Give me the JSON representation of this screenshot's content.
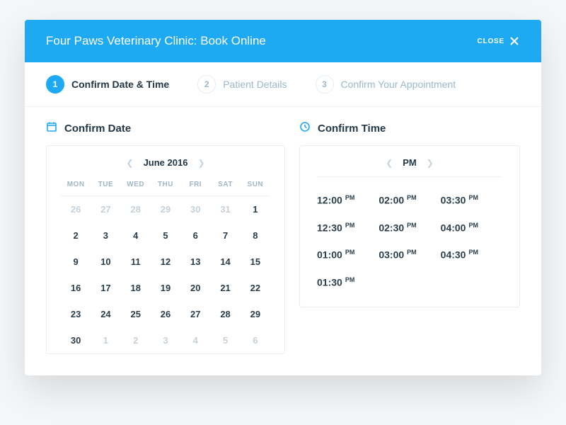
{
  "header": {
    "title": "Four Paws Veterinary Clinic: Book Online",
    "close_label": "CLOSE"
  },
  "steps": [
    {
      "num": "1",
      "label": "Confirm Date & Time",
      "active": true
    },
    {
      "num": "2",
      "label": "Patient Details",
      "active": false
    },
    {
      "num": "3",
      "label": "Confirm Your Appointment",
      "active": false
    }
  ],
  "date_panel": {
    "title": "Confirm Date",
    "month_label": "June 2016"
  },
  "dow": [
    "MON",
    "TUE",
    "WED",
    "THU",
    "FRI",
    "SAT",
    "SUN"
  ],
  "weeks": [
    [
      {
        "d": "26",
        "m": true
      },
      {
        "d": "27",
        "m": true
      },
      {
        "d": "28",
        "m": true
      },
      {
        "d": "29",
        "m": true
      },
      {
        "d": "30",
        "m": true
      },
      {
        "d": "31",
        "m": true
      },
      {
        "d": "1",
        "m": false
      }
    ],
    [
      {
        "d": "2"
      },
      {
        "d": "3"
      },
      {
        "d": "4"
      },
      {
        "d": "5"
      },
      {
        "d": "6"
      },
      {
        "d": "7"
      },
      {
        "d": "8"
      }
    ],
    [
      {
        "d": "9"
      },
      {
        "d": "10"
      },
      {
        "d": "11"
      },
      {
        "d": "12"
      },
      {
        "d": "13"
      },
      {
        "d": "14"
      },
      {
        "d": "15"
      }
    ],
    [
      {
        "d": "16"
      },
      {
        "d": "17"
      },
      {
        "d": "18"
      },
      {
        "d": "19"
      },
      {
        "d": "20"
      },
      {
        "d": "21"
      },
      {
        "d": "22"
      }
    ],
    [
      {
        "d": "23"
      },
      {
        "d": "24"
      },
      {
        "d": "25"
      },
      {
        "d": "26"
      },
      {
        "d": "27"
      },
      {
        "d": "28"
      },
      {
        "d": "29"
      }
    ],
    [
      {
        "d": "30"
      },
      {
        "d": "1",
        "m": true
      },
      {
        "d": "2",
        "m": true
      },
      {
        "d": "3",
        "m": true
      },
      {
        "d": "4",
        "m": true
      },
      {
        "d": "5",
        "m": true
      },
      {
        "d": "6",
        "m": true
      }
    ]
  ],
  "time_panel": {
    "title": "Confirm Time",
    "period": "PM"
  },
  "time_slots": [
    {
      "t": "12:00",
      "p": "PM"
    },
    {
      "t": "02:00",
      "p": "PM"
    },
    {
      "t": "03:30",
      "p": "PM"
    },
    {
      "t": "12:30",
      "p": "PM"
    },
    {
      "t": "02:30",
      "p": "PM"
    },
    {
      "t": "04:00",
      "p": "PM"
    },
    {
      "t": "01:00",
      "p": "PM"
    },
    {
      "t": "03:00",
      "p": "PM"
    },
    {
      "t": "04:30",
      "p": "PM"
    },
    {
      "t": "01:30",
      "p": "PM"
    }
  ]
}
